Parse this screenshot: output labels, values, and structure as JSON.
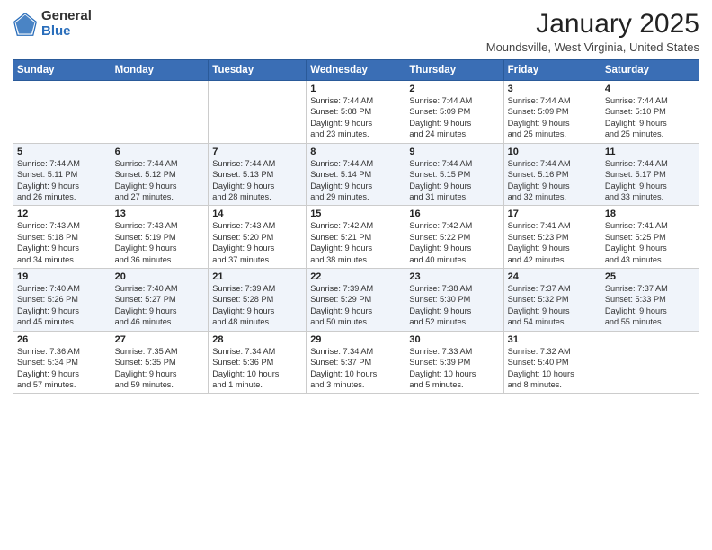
{
  "header": {
    "logo_general": "General",
    "logo_blue": "Blue",
    "month_title": "January 2025",
    "location": "Moundsville, West Virginia, United States"
  },
  "weekdays": [
    "Sunday",
    "Monday",
    "Tuesday",
    "Wednesday",
    "Thursday",
    "Friday",
    "Saturday"
  ],
  "weeks": [
    [
      {
        "day": "",
        "info": ""
      },
      {
        "day": "",
        "info": ""
      },
      {
        "day": "",
        "info": ""
      },
      {
        "day": "1",
        "info": "Sunrise: 7:44 AM\nSunset: 5:08 PM\nDaylight: 9 hours\nand 23 minutes."
      },
      {
        "day": "2",
        "info": "Sunrise: 7:44 AM\nSunset: 5:09 PM\nDaylight: 9 hours\nand 24 minutes."
      },
      {
        "day": "3",
        "info": "Sunrise: 7:44 AM\nSunset: 5:09 PM\nDaylight: 9 hours\nand 25 minutes."
      },
      {
        "day": "4",
        "info": "Sunrise: 7:44 AM\nSunset: 5:10 PM\nDaylight: 9 hours\nand 25 minutes."
      }
    ],
    [
      {
        "day": "5",
        "info": "Sunrise: 7:44 AM\nSunset: 5:11 PM\nDaylight: 9 hours\nand 26 minutes."
      },
      {
        "day": "6",
        "info": "Sunrise: 7:44 AM\nSunset: 5:12 PM\nDaylight: 9 hours\nand 27 minutes."
      },
      {
        "day": "7",
        "info": "Sunrise: 7:44 AM\nSunset: 5:13 PM\nDaylight: 9 hours\nand 28 minutes."
      },
      {
        "day": "8",
        "info": "Sunrise: 7:44 AM\nSunset: 5:14 PM\nDaylight: 9 hours\nand 29 minutes."
      },
      {
        "day": "9",
        "info": "Sunrise: 7:44 AM\nSunset: 5:15 PM\nDaylight: 9 hours\nand 31 minutes."
      },
      {
        "day": "10",
        "info": "Sunrise: 7:44 AM\nSunset: 5:16 PM\nDaylight: 9 hours\nand 32 minutes."
      },
      {
        "day": "11",
        "info": "Sunrise: 7:44 AM\nSunset: 5:17 PM\nDaylight: 9 hours\nand 33 minutes."
      }
    ],
    [
      {
        "day": "12",
        "info": "Sunrise: 7:43 AM\nSunset: 5:18 PM\nDaylight: 9 hours\nand 34 minutes."
      },
      {
        "day": "13",
        "info": "Sunrise: 7:43 AM\nSunset: 5:19 PM\nDaylight: 9 hours\nand 36 minutes."
      },
      {
        "day": "14",
        "info": "Sunrise: 7:43 AM\nSunset: 5:20 PM\nDaylight: 9 hours\nand 37 minutes."
      },
      {
        "day": "15",
        "info": "Sunrise: 7:42 AM\nSunset: 5:21 PM\nDaylight: 9 hours\nand 38 minutes."
      },
      {
        "day": "16",
        "info": "Sunrise: 7:42 AM\nSunset: 5:22 PM\nDaylight: 9 hours\nand 40 minutes."
      },
      {
        "day": "17",
        "info": "Sunrise: 7:41 AM\nSunset: 5:23 PM\nDaylight: 9 hours\nand 42 minutes."
      },
      {
        "day": "18",
        "info": "Sunrise: 7:41 AM\nSunset: 5:25 PM\nDaylight: 9 hours\nand 43 minutes."
      }
    ],
    [
      {
        "day": "19",
        "info": "Sunrise: 7:40 AM\nSunset: 5:26 PM\nDaylight: 9 hours\nand 45 minutes."
      },
      {
        "day": "20",
        "info": "Sunrise: 7:40 AM\nSunset: 5:27 PM\nDaylight: 9 hours\nand 46 minutes."
      },
      {
        "day": "21",
        "info": "Sunrise: 7:39 AM\nSunset: 5:28 PM\nDaylight: 9 hours\nand 48 minutes."
      },
      {
        "day": "22",
        "info": "Sunrise: 7:39 AM\nSunset: 5:29 PM\nDaylight: 9 hours\nand 50 minutes."
      },
      {
        "day": "23",
        "info": "Sunrise: 7:38 AM\nSunset: 5:30 PM\nDaylight: 9 hours\nand 52 minutes."
      },
      {
        "day": "24",
        "info": "Sunrise: 7:37 AM\nSunset: 5:32 PM\nDaylight: 9 hours\nand 54 minutes."
      },
      {
        "day": "25",
        "info": "Sunrise: 7:37 AM\nSunset: 5:33 PM\nDaylight: 9 hours\nand 55 minutes."
      }
    ],
    [
      {
        "day": "26",
        "info": "Sunrise: 7:36 AM\nSunset: 5:34 PM\nDaylight: 9 hours\nand 57 minutes."
      },
      {
        "day": "27",
        "info": "Sunrise: 7:35 AM\nSunset: 5:35 PM\nDaylight: 9 hours\nand 59 minutes."
      },
      {
        "day": "28",
        "info": "Sunrise: 7:34 AM\nSunset: 5:36 PM\nDaylight: 10 hours\nand 1 minute."
      },
      {
        "day": "29",
        "info": "Sunrise: 7:34 AM\nSunset: 5:37 PM\nDaylight: 10 hours\nand 3 minutes."
      },
      {
        "day": "30",
        "info": "Sunrise: 7:33 AM\nSunset: 5:39 PM\nDaylight: 10 hours\nand 5 minutes."
      },
      {
        "day": "31",
        "info": "Sunrise: 7:32 AM\nSunset: 5:40 PM\nDaylight: 10 hours\nand 8 minutes."
      },
      {
        "day": "",
        "info": ""
      }
    ]
  ]
}
